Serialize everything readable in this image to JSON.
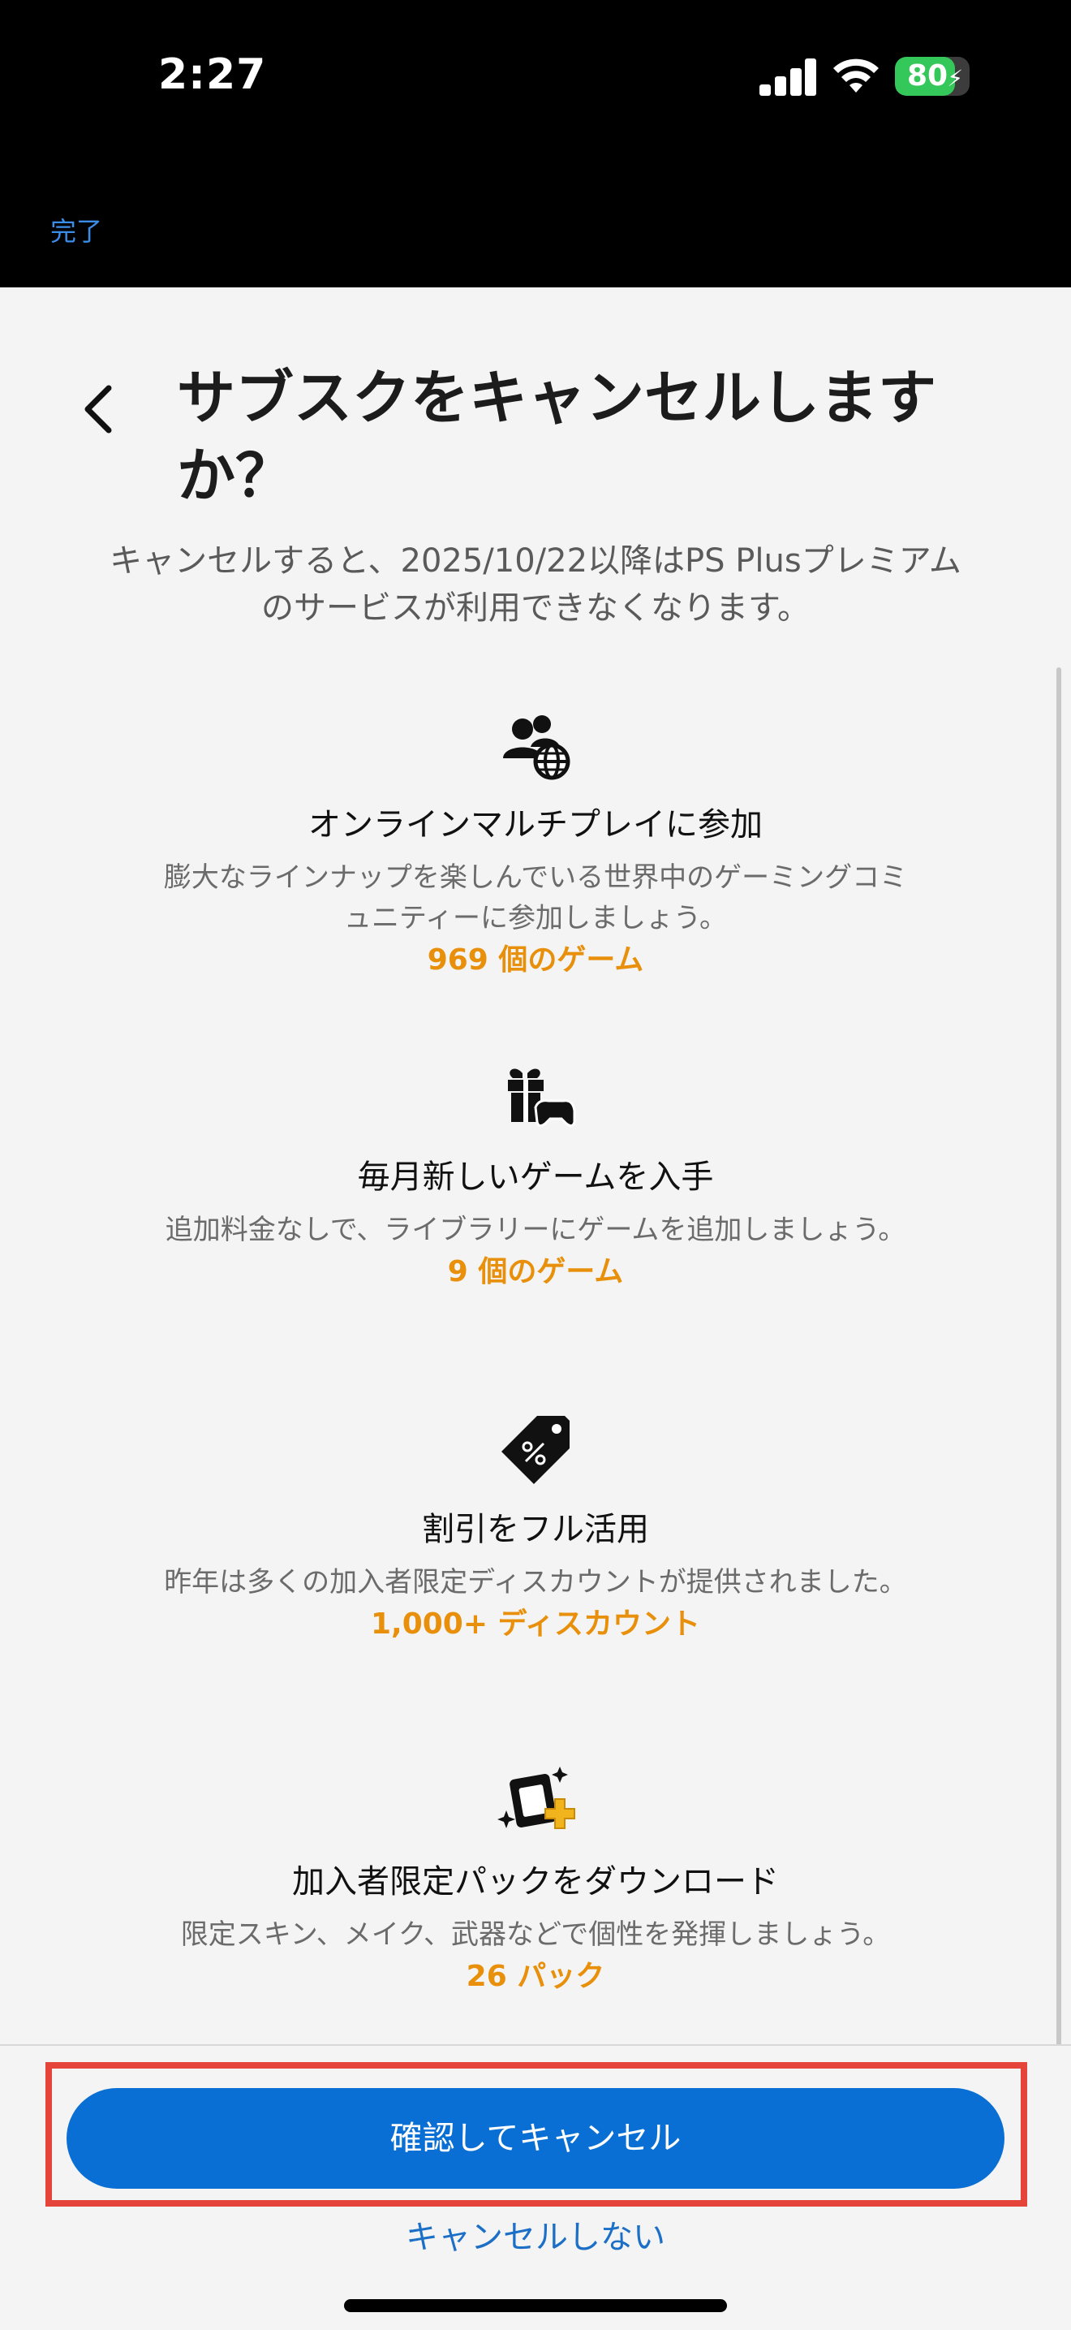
{
  "status_bar": {
    "time": "2:27",
    "battery_percent": "80",
    "battery_level": 0.8
  },
  "nav": {
    "done_label": "完了"
  },
  "header": {
    "title": "サブスクをキャンセルしますか？",
    "subtitle": "キャンセルすると、2025/10/22以降はPS Plusプレミアムのサービスが利用できなくなります。"
  },
  "features": [
    {
      "icon": "online-multiplayer-icon",
      "title": "オンラインマルチプレイに参加",
      "description": "膨大なラインナップを楽しんでいる世界中のゲーミングコミュニティーに参加しましょう。",
      "count": "969 個のゲーム"
    },
    {
      "icon": "monthly-games-gift-icon",
      "title": "毎月新しいゲームを入手",
      "description": "追加料金なしで、ライブラリーにゲームを追加しましょう。",
      "count": "9 個のゲーム"
    },
    {
      "icon": "discount-tag-icon",
      "title": "割引をフル活用",
      "description": "昨年は多くの加入者限定ディスカウントが提供されました。",
      "count": "1,000+ ディスカウント"
    },
    {
      "icon": "exclusive-packs-icon",
      "title": "加入者限定パックをダウンロード",
      "description": "限定スキン、メイク、武器などで個性を発揮しましょう。",
      "count": "26 パック"
    }
  ],
  "footer": {
    "confirm_label": "確認してキャンセル",
    "keep_label": "キャンセルしない"
  },
  "colors": {
    "accent": "#0a6fd4",
    "count_highlight": "#e8900c",
    "highlight_frame": "#e5443a",
    "link": "#1c6fc6"
  }
}
